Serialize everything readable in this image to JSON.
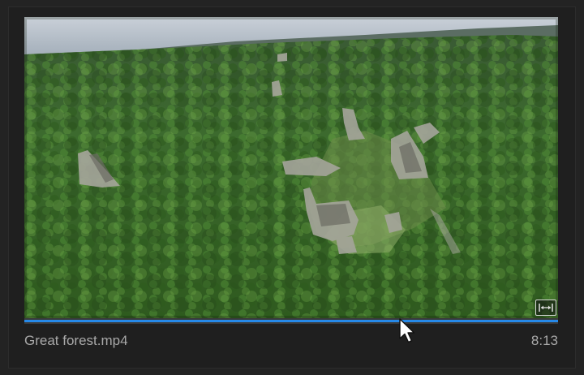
{
  "clip": {
    "file_name": "Great forest.mp4",
    "duration": "8:13",
    "playhead_fraction": 0.705
  },
  "icons": {
    "scale_toggle": "fit-to-frame-icon",
    "cursor": "mouse-pointer-icon"
  },
  "colors": {
    "panel_bg": "#1f1f1f",
    "scrubber_accent": "#2689e8",
    "text_muted": "#a9a9a9"
  }
}
